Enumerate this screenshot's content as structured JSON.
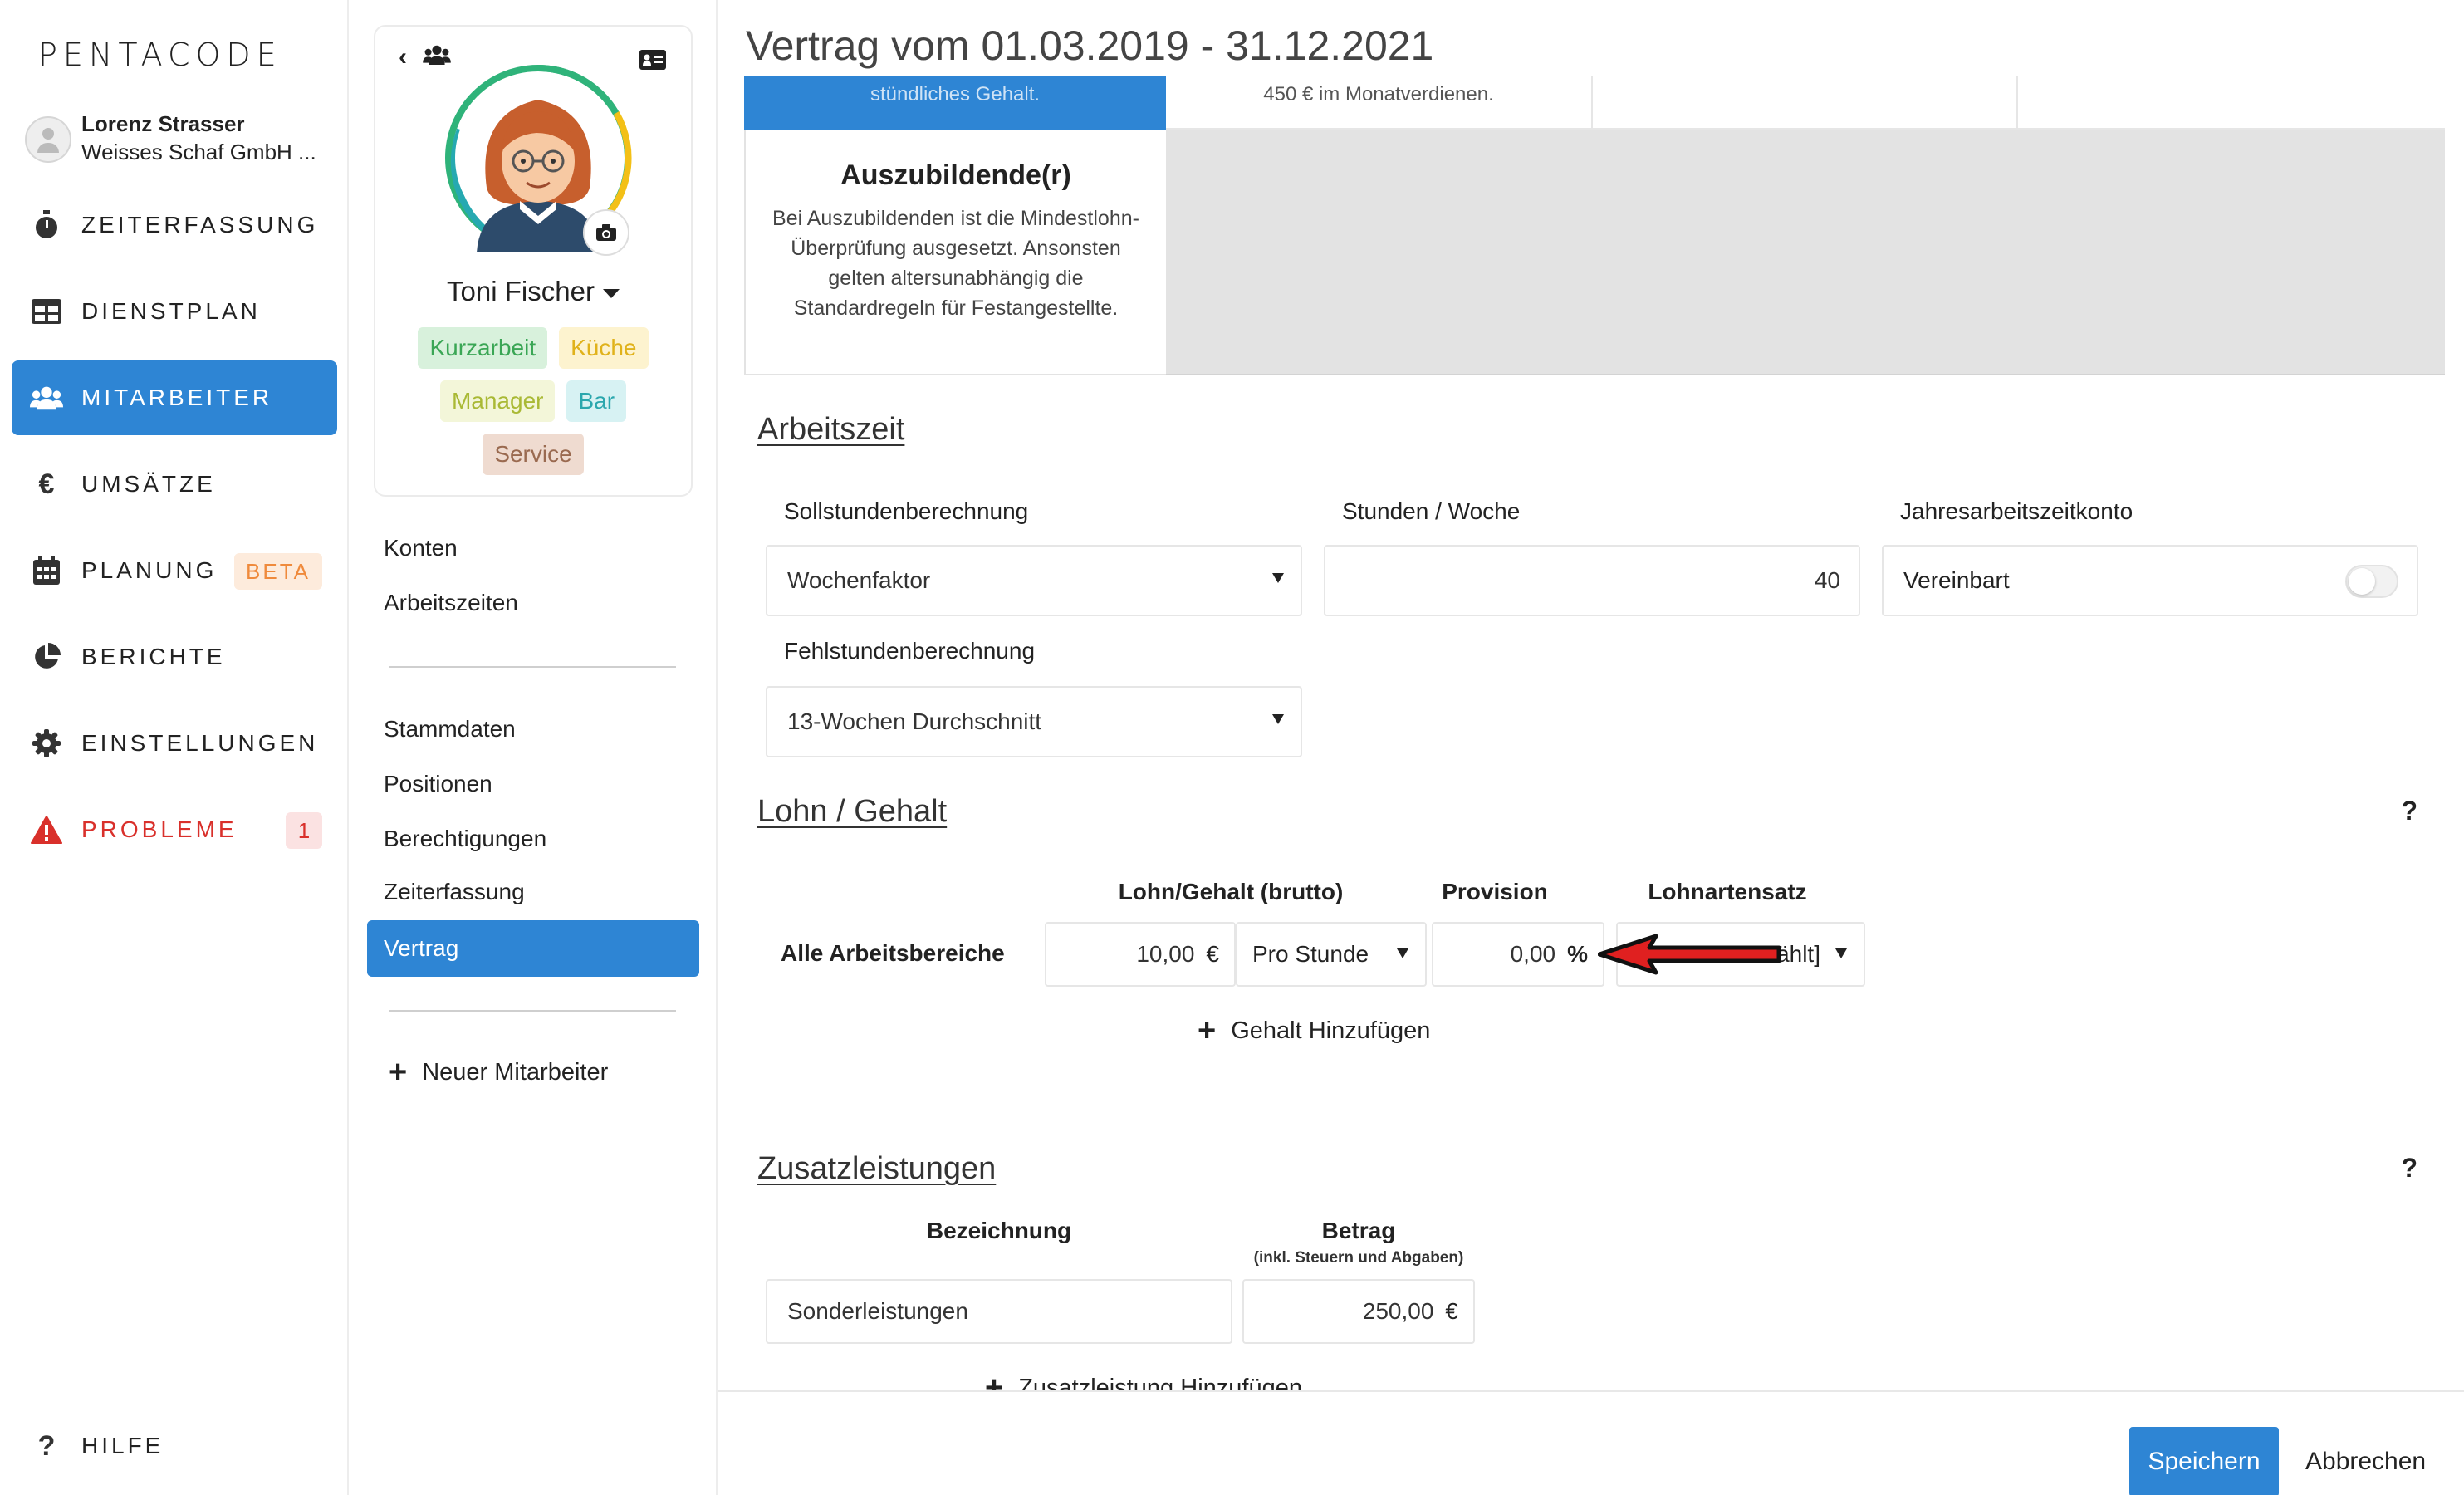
{
  "app": {
    "logo": "PENTACODE"
  },
  "user": {
    "name": "Lorenz Strasser",
    "company": "Weisses Schaf GmbH ..."
  },
  "nav": {
    "items": [
      {
        "label": "ZEITERFASSUNG",
        "icon": "stopwatch-icon"
      },
      {
        "label": "DIENSTPLAN",
        "icon": "table-icon"
      },
      {
        "label": "MITARBEITER",
        "icon": "users-icon"
      },
      {
        "label": "UMSÄTZE",
        "icon": "euro-icon"
      },
      {
        "label": "PLANUNG",
        "icon": "calendar-icon",
        "badge": "BETA"
      },
      {
        "label": "BERICHTE",
        "icon": "pie-chart-icon"
      },
      {
        "label": "EINSTELLUNGEN",
        "icon": "gear-icon"
      },
      {
        "label": "PROBLEME",
        "icon": "warning-icon",
        "badge": "1"
      }
    ],
    "help": "HILFE"
  },
  "profile": {
    "name": "Toni Fischer",
    "tags": [
      {
        "label": "Kurzarbeit",
        "bg": "#d8f1dc",
        "fg": "#3aa655"
      },
      {
        "label": "Küche",
        "bg": "#fdf3cf",
        "fg": "#e0b21b"
      },
      {
        "label": "Manager",
        "bg": "#f3f6d9",
        "fg": "#a9b935"
      },
      {
        "label": "Bar",
        "bg": "#d7f2f3",
        "fg": "#2aa7ad"
      },
      {
        "label": "Service",
        "bg": "#efdbd0",
        "fg": "#9a6a50"
      }
    ],
    "links_a": [
      "Konten",
      "Arbeitszeiten"
    ],
    "links_b": [
      "Stammdaten",
      "Positionen",
      "Berechtigungen",
      "Zeiterfassung",
      "Vertrag"
    ],
    "new_employee": "Neuer Mitarbeiter"
  },
  "main": {
    "title": "Vertrag vom 01.03.2019 - 31.12.2021",
    "strip": {
      "blue_text": "stündliches Gehalt.",
      "text": "450 € im Monatverdienen."
    },
    "azubi": {
      "title": "Auszubildende(r)",
      "text": "Bei Auszubildenden ist die Mindestlohn-Überprüfung ausgesetzt. Ansonsten gelten altersunabhängig die Standardregeln für Festangestellte."
    },
    "arbeitszeit": {
      "title": "Arbeitszeit",
      "soll_label": "Sollstundenberechnung",
      "soll_value": "Wochenfaktor",
      "stunden_label": "Stunden / Woche",
      "stunden_value": "40",
      "jahres_label": "Jahresarbeitszeitkonto",
      "jahres_value": "Vereinbart",
      "fehl_label": "Fehlstundenberechnung",
      "fehl_value": "13-Wochen Durchschnitt"
    },
    "lohn": {
      "title": "Lohn / Gehalt",
      "help": "?",
      "col_lohn": "Lohn/Gehalt (brutto)",
      "col_provision": "Provision",
      "col_lohnart": "Lohnartensatz",
      "row_label": "Alle Arbeitsbereiche",
      "amount": "10,00",
      "currency": "€",
      "period": "Pro Stunde",
      "provision": "0,00",
      "percent": "%",
      "lohnart_value": "ählt]",
      "add": "Gehalt Hinzufügen"
    },
    "zusatz": {
      "title": "Zusatzleistungen",
      "help": "?",
      "col_bez": "Bezeichnung",
      "col_betrag": "Betrag",
      "col_betrag_note": "(inkl. Steuern und Abgaben)",
      "bez_value": "Sonderleistungen",
      "betrag_value": "250,00",
      "currency": "€",
      "add": "Zusatzleistung Hinzufügen"
    },
    "footer": {
      "save": "Speichern",
      "cancel": "Abbrechen"
    }
  },
  "colors": {
    "accent": "#2e85d4",
    "danger": "#d9302b",
    "beta": "#ef8a3c",
    "arrow": "#e02020"
  }
}
